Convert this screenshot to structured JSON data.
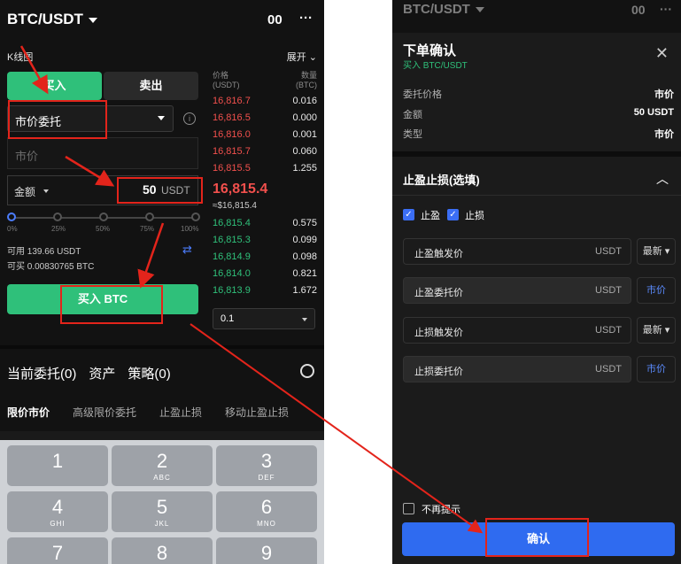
{
  "left": {
    "pair": "BTC/USDT",
    "header_icon": "00",
    "more": "···",
    "kline": "K线图",
    "expand": "展开",
    "buy_tab": "买入",
    "sell_tab": "卖出",
    "order_type": "市价委托",
    "price_placeholder": "市价",
    "amount_label": "金额",
    "amount_value": "50",
    "amount_unit": "USDT",
    "slider_marks": [
      "0%",
      "25%",
      "50%",
      "75%",
      "100%"
    ],
    "available_label": "可用",
    "available_value": "139.66 USDT",
    "can_buy_label": "可买",
    "can_buy_value": "0.00830765 BTC",
    "buy_button": "买入 BTC",
    "orderbook_header_price": "价格",
    "orderbook_header_price_unit": "(USDT)",
    "orderbook_header_qty": "数量",
    "orderbook_header_qty_unit": "(BTC)",
    "asks": [
      {
        "p": "16,816.7",
        "q": "0.016"
      },
      {
        "p": "16,816.5",
        "q": "0.000"
      },
      {
        "p": "16,816.0",
        "q": "0.001"
      },
      {
        "p": "16,815.7",
        "q": "0.060"
      },
      {
        "p": "16,815.5",
        "q": "1.255"
      }
    ],
    "last_price": "16,815.4",
    "last_price_fiat": "≈$16,815.4",
    "bids": [
      {
        "p": "16,815.4",
        "q": "0.575"
      },
      {
        "p": "16,815.3",
        "q": "0.099"
      },
      {
        "p": "16,814.9",
        "q": "0.098"
      },
      {
        "p": "16,814.0",
        "q": "0.821"
      },
      {
        "p": "16,813.9",
        "q": "1.672"
      }
    ],
    "depth_select": "0.1",
    "tabs": [
      "当前委托(0)",
      "资产",
      "策略(0)"
    ],
    "subtabs": [
      "限价市价",
      "高级限价委托",
      "止盈止损",
      "移动止盈止损"
    ],
    "keys": [
      {
        "n": "1",
        "l": ""
      },
      {
        "n": "2",
        "l": "ABC"
      },
      {
        "n": "3",
        "l": "DEF"
      },
      {
        "n": "4",
        "l": "GHI"
      },
      {
        "n": "5",
        "l": "JKL"
      },
      {
        "n": "6",
        "l": "MNO"
      },
      {
        "n": "7",
        "l": ""
      },
      {
        "n": "8",
        "l": ""
      },
      {
        "n": "9",
        "l": ""
      }
    ]
  },
  "right": {
    "pair": "BTC/USDT",
    "header_icon": "00",
    "more": "···",
    "title": "下单确认",
    "subtitle": "买入 BTC/USDT",
    "rows": [
      {
        "k": "委托价格",
        "v": "市价"
      },
      {
        "k": "金额",
        "v": "50 USDT"
      },
      {
        "k": "类型",
        "v": "市价"
      }
    ],
    "tpsl_title": "止盈止损(选填)",
    "chk_tp": "止盈",
    "chk_sl": "止损",
    "fields": [
      {
        "label": "止盈触发价",
        "unit": "USDT",
        "side": "最新"
      },
      {
        "label": "止盈委托价",
        "unit": "USDT",
        "side": "市价"
      },
      {
        "label": "止损触发价",
        "unit": "USDT",
        "side": "最新"
      },
      {
        "label": "止损委托价",
        "unit": "USDT",
        "side": "市价"
      }
    ],
    "no_remind": "不再提示",
    "confirm": "确认"
  },
  "colors": {
    "green": "#2fc07a",
    "red": "#f2504d",
    "blue": "#2f6bf0",
    "annotation": "#e3241b"
  }
}
